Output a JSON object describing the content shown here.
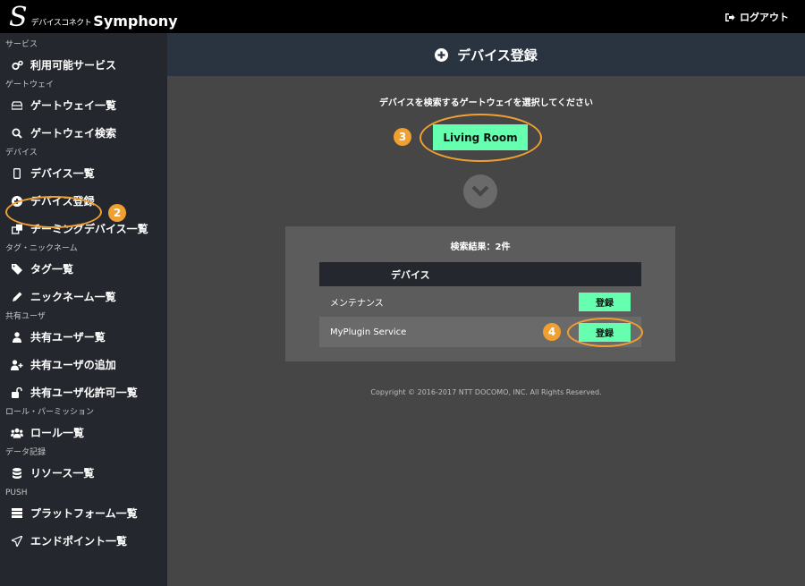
{
  "topbar": {
    "logo_mark": "S",
    "logo_jp": "デバイスコネクト",
    "logo_en": "Symphony",
    "logout_label": "ログアウト",
    "logout_icon": "sign-out-icon"
  },
  "sidebar": {
    "sections": [
      {
        "label": "サービス",
        "items": [
          {
            "label": "利用可能サービス",
            "icon": "cogs-icon"
          }
        ]
      },
      {
        "label": "ゲートウェイ",
        "items": [
          {
            "label": "ゲートウェイ一覧",
            "icon": "hdd-icon"
          },
          {
            "label": "ゲートウェイ検索",
            "icon": "search-icon"
          }
        ]
      },
      {
        "label": "デバイス",
        "items": [
          {
            "label": "デバイス一覧",
            "icon": "mobile-icon"
          },
          {
            "label": "デバイス登録",
            "icon": "plus-circle-icon"
          },
          {
            "label": "チーミングデバイス一覧",
            "icon": "clone-icon"
          }
        ]
      },
      {
        "label": "タグ・ニックネーム",
        "items": [
          {
            "label": "タグ一覧",
            "icon": "tags-icon"
          },
          {
            "label": "ニックネーム一覧",
            "icon": "pencil-icon"
          }
        ]
      },
      {
        "label": "共有ユーザ",
        "items": [
          {
            "label": "共有ユーザー覧",
            "icon": "user-icon"
          },
          {
            "label": "共有ユーザの追加",
            "icon": "user-plus-icon"
          },
          {
            "label": "共有ユーザ化許可一覧",
            "icon": "unlock-icon"
          }
        ]
      },
      {
        "label": "ロール・パーミッション",
        "items": [
          {
            "label": "ロール一覧",
            "icon": "users-icon"
          }
        ]
      },
      {
        "label": "データ記録",
        "items": [
          {
            "label": "リソース一覧",
            "icon": "database-icon"
          }
        ]
      },
      {
        "label": "PUSH",
        "items": [
          {
            "label": "プラットフォーム一覧",
            "icon": "server-icon"
          },
          {
            "label": "エンドポイント一覧",
            "icon": "send-icon"
          }
        ]
      }
    ]
  },
  "main": {
    "title": "デバイス登録",
    "title_icon": "plus-circle-icon",
    "prompt": "デバイスを検索するゲートウェイを選択してください",
    "gateway_button": "Living Room",
    "chevron_icon": "chevron-circle-down-icon",
    "results": {
      "title": "検索結果：2件",
      "column_header": "デバイス",
      "rows": [
        {
          "name": "メンテナンス",
          "button": "登録"
        },
        {
          "name": "MyPlugin Service",
          "button": "登録"
        }
      ]
    },
    "footer": "Copyright © 2016-2017 NTT DOCOMO, INC. All Rights Reserved."
  },
  "annotations": {
    "badge_2": "2",
    "badge_3": "3",
    "badge_4": "4",
    "accent_color": "#f0a030",
    "button_color": "#66ffb0"
  }
}
